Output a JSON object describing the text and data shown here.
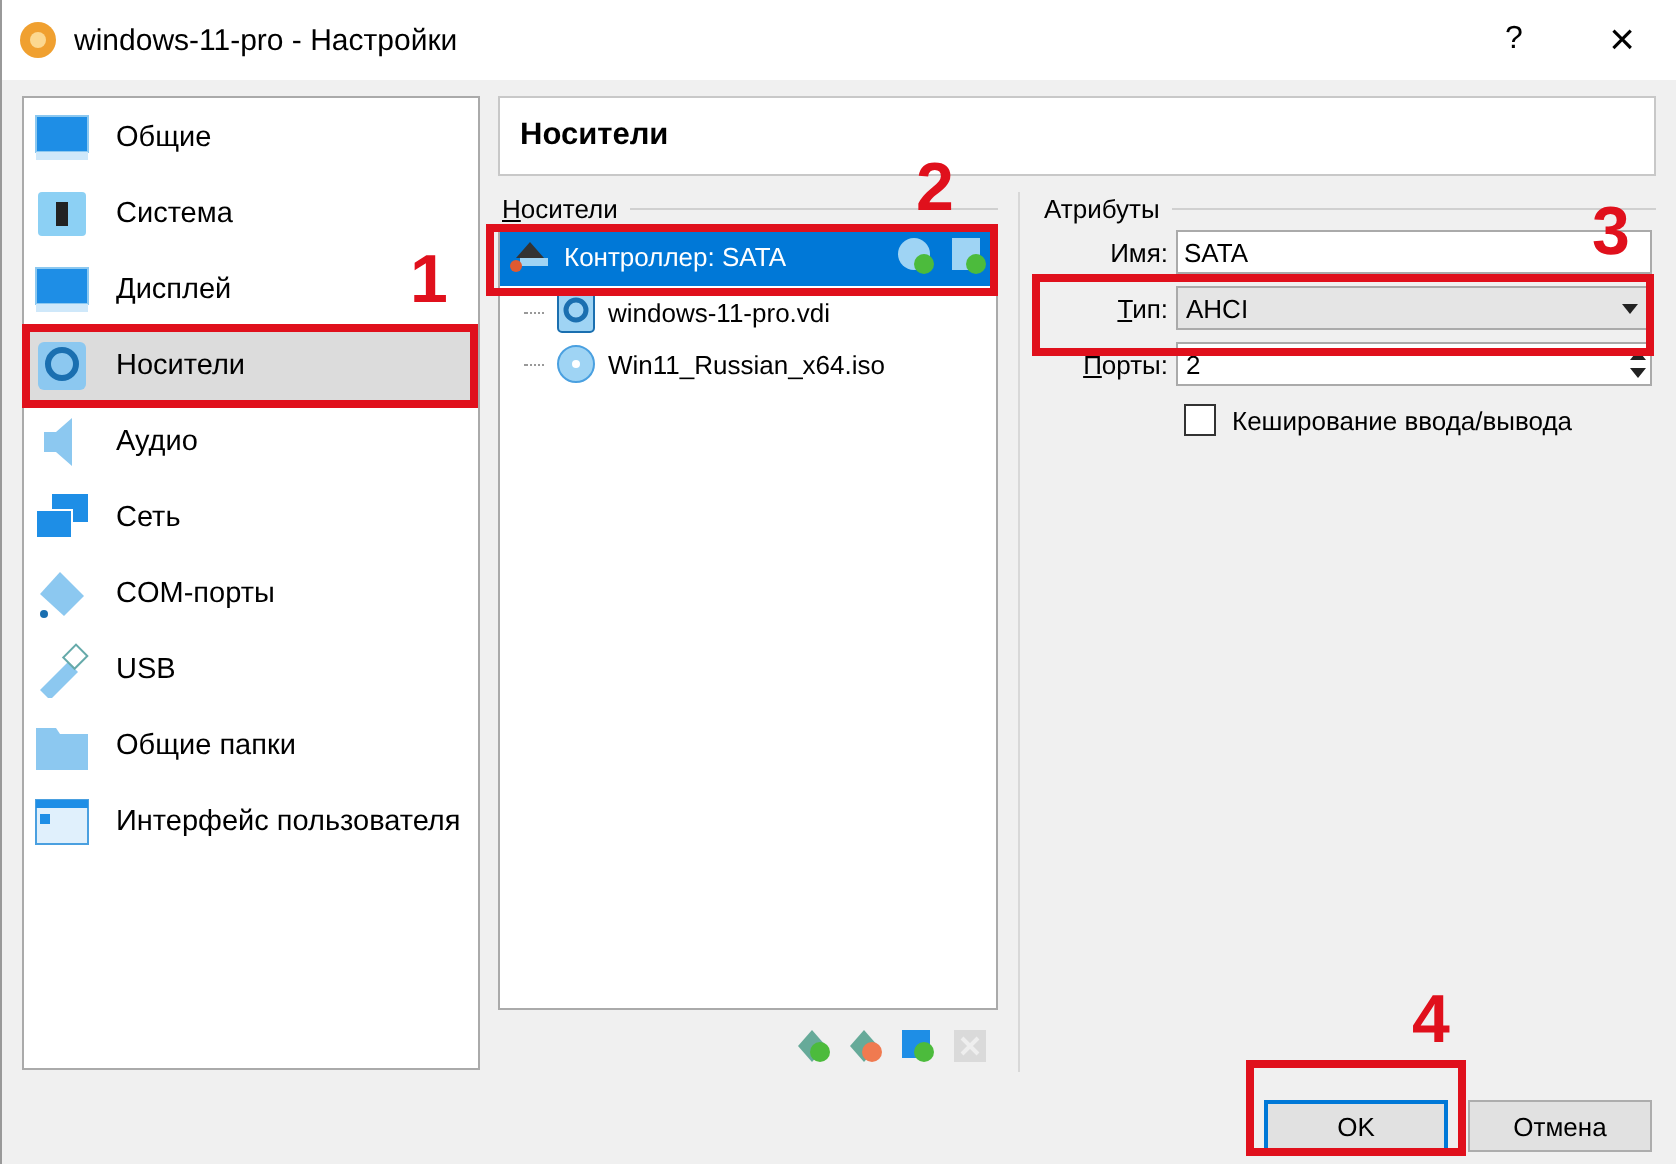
{
  "window": {
    "title": "windows-11-pro - Настройки",
    "help": "?",
    "close": "×"
  },
  "sidebar": {
    "items": [
      {
        "label": "Общие",
        "selected": false
      },
      {
        "label": "Система",
        "selected": false
      },
      {
        "label": "Дисплей",
        "selected": false
      },
      {
        "label": "Носители",
        "selected": true
      },
      {
        "label": "Аудио",
        "selected": false
      },
      {
        "label": "Сеть",
        "selected": false
      },
      {
        "label": "COM-порты",
        "selected": false
      },
      {
        "label": "USB",
        "selected": false
      },
      {
        "label": "Общие папки",
        "selected": false
      },
      {
        "label": "Интерфейс пользователя",
        "selected": false
      }
    ]
  },
  "page_title": "Носители",
  "storage": {
    "group_label": "Носители",
    "tree": [
      {
        "label": "Контроллер: SATA",
        "kind": "controller",
        "selected": true,
        "children": [
          {
            "label": "windows-11-pro.vdi",
            "kind": "disk",
            "selected": false
          },
          {
            "label": "Win11_Russian_x64.iso",
            "kind": "optical",
            "selected": false
          }
        ]
      }
    ],
    "tools": [
      {
        "kind": "add-controller",
        "disabled": false
      },
      {
        "kind": "remove-controller",
        "disabled": false
      },
      {
        "kind": "add-attachment",
        "disabled": false
      },
      {
        "kind": "remove-attachment",
        "disabled": true
      }
    ]
  },
  "attributes": {
    "group_label": "Атрибуты",
    "name_label": "Имя:",
    "name_value": "SATA",
    "type_label": "Тип:",
    "type_value": "AHCI",
    "ports_label": "Порты:",
    "ports_value": "2",
    "cache": {
      "label": "Кеширование ввода/вывода",
      "checked": false
    }
  },
  "buttons": [
    {
      "label": "OK",
      "default": true
    },
    {
      "label": "Отмена",
      "default": false
    }
  ],
  "annotations": [
    {
      "label": "1"
    },
    {
      "label": "2"
    },
    {
      "label": "3"
    },
    {
      "label": "4"
    }
  ]
}
